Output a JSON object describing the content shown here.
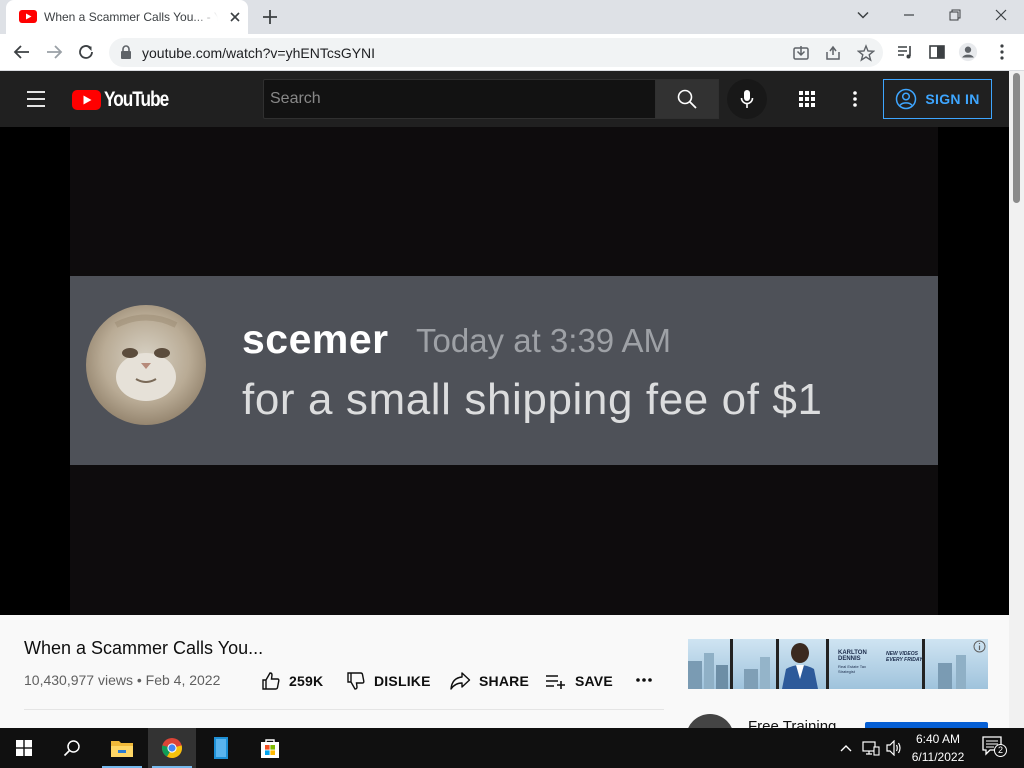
{
  "browser": {
    "tab_title": "When a Scammer Calls You... - YouTube",
    "url": "youtube.com/watch?v=yhENTcsGYNI",
    "icons": [
      "youtube-favicon",
      "close-icon",
      "plus-icon",
      "chevron-down-icon",
      "minimize-icon",
      "restore-icon",
      "close-icon",
      "back-icon",
      "forward-icon",
      "reload-icon",
      "lock-icon",
      "install-icon",
      "share-icon",
      "star-icon",
      "media-icon",
      "sidepanel-icon",
      "profile-icon",
      "kebab-icon"
    ]
  },
  "youtube": {
    "logo_text": "YouTube",
    "search_placeholder": "Search",
    "signin_label": "SIGN IN",
    "accent_color": "#3ea6ff",
    "brand_red": "#ff0000"
  },
  "video": {
    "username": "scemer",
    "timestamp": "Today at 3:39 AM",
    "message": "for a small shipping fee of $1"
  },
  "info": {
    "title": "When a Scammer Calls You...",
    "views": "10,430,977 views",
    "separator": "•",
    "date": "Feb 4, 2022",
    "like_count": "259K",
    "dislike_label": "DISLIKE",
    "share_label": "SHARE",
    "save_label": "SAVE"
  },
  "ad": {
    "name": "KARLTON DENNIS",
    "subtitle": "Real Estate Tax Strategist",
    "tagline": "NEW VIDEOS EVERY FRIDAY"
  },
  "recommendation": {
    "title": "Free Training"
  },
  "taskbar": {
    "time": "6:40 AM",
    "date": "6/11/2022",
    "notification_count": "2"
  }
}
